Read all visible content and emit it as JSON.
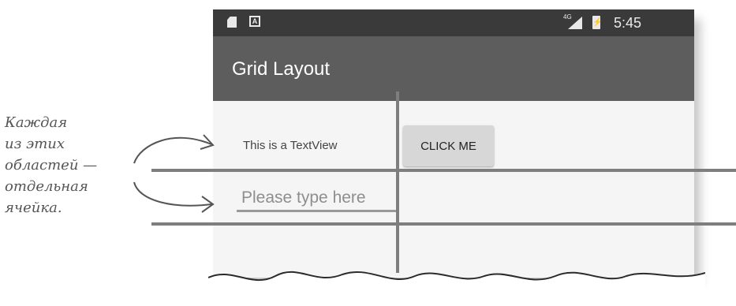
{
  "status_bar": {
    "network": "4G",
    "time": "5:45",
    "icons": [
      "sd-card-icon",
      "keyboard-a-icon",
      "signal-icon",
      "battery-charging-icon"
    ]
  },
  "app_bar": {
    "title": "Grid Layout"
  },
  "cells": {
    "textview": "This is a TextView",
    "button_label": "CLICK ME",
    "edit_placeholder": "Please type here"
  },
  "annotation": {
    "lines": [
      "Каждая",
      "из этих",
      "областей —",
      "отдельная",
      "ячейка."
    ]
  },
  "colors": {
    "status_bar": "#3a3a3a",
    "app_bar": "#5d5d5d",
    "grid_lines": "#7e7e7e"
  }
}
